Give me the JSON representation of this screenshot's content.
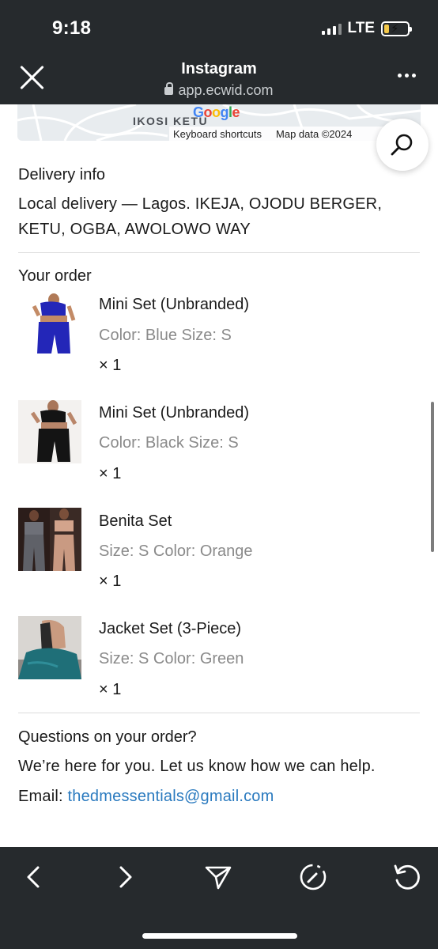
{
  "status_bar": {
    "time": "9:18",
    "network": "LTE",
    "battery_level": 0.2,
    "battery_charging": true,
    "signal_icon": "cellular-signal-icon"
  },
  "browser": {
    "title": "Instagram",
    "url": "app.ecwid.com",
    "close_icon": "close-icon",
    "more_icon": "more-dots-icon"
  },
  "map": {
    "place_label": "IKOSI KETU",
    "logo": "Google",
    "keyboard_shortcuts": "Keyboard shortcuts",
    "map_data": "Map data ©2024"
  },
  "delivery": {
    "title": "Delivery info",
    "line1": "Local delivery — Lagos. IKEJA, OJODU BERGER,",
    "line2": "KETU, OGBA, AWOLOWO WAY"
  },
  "order": {
    "title": "Your order",
    "items": [
      {
        "name": "Mini Set (Unbranded)",
        "options": "Color: Blue  Size: S",
        "qty": "× 1",
        "swatch": "#2326b8"
      },
      {
        "name": "Mini Set (Unbranded)",
        "options": "Color: Black  Size: S",
        "qty": "× 1",
        "swatch": "#141414"
      },
      {
        "name": "Benita Set",
        "options": "Size: S  Color: Orange",
        "qty": "× 1",
        "swatch": "#c99a82"
      },
      {
        "name": "Jacket Set (3-Piece)",
        "options": "Size: S  Color: Green",
        "qty": "× 1",
        "swatch": "#1f6f78"
      }
    ]
  },
  "questions": {
    "title": "Questions on your order?",
    "text": "We’re here for you. Let us know how we can help.",
    "email_label": "Email: ",
    "email": "thedmessentials@gmail.com"
  },
  "bottom_nav": {
    "back_icon": "back-chevron-icon",
    "forward_icon": "forward-chevron-icon",
    "share_icon": "send-icon",
    "compass_icon": "compass-icon",
    "reload_icon": "reload-icon"
  },
  "colors": {
    "chrome_bg": "#262a2d",
    "link": "#2a7abf",
    "muted_text": "#8a8a8a"
  }
}
